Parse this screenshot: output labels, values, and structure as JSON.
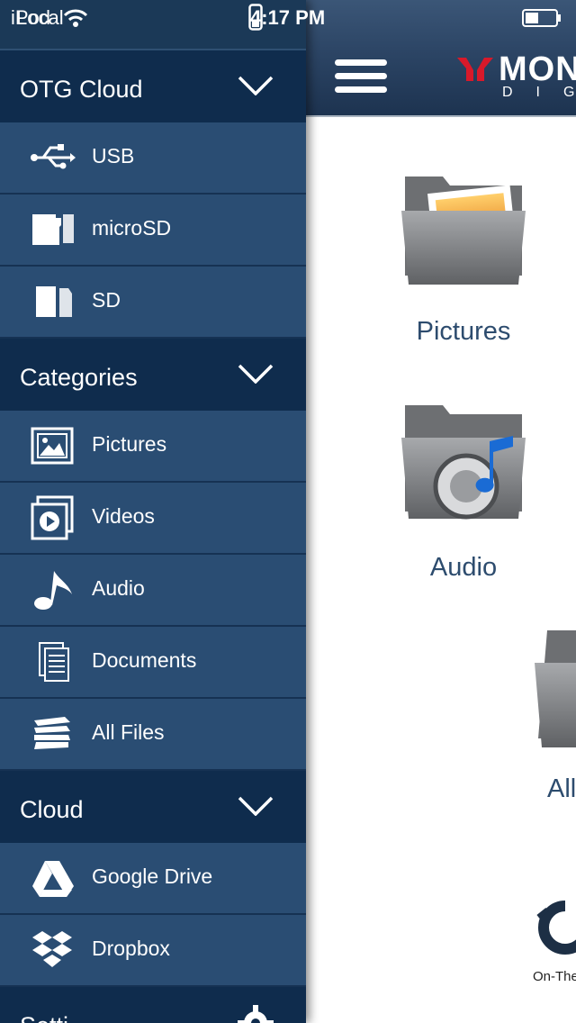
{
  "status_bar": {
    "carrier": "iPod",
    "time": "4:17 PM"
  },
  "drawer": {
    "top_label": "Local",
    "sections": [
      {
        "title": "OTG Cloud",
        "items": [
          {
            "label": "USB",
            "icon": "usb-icon"
          },
          {
            "label": "microSD",
            "icon": "microsd-icon"
          },
          {
            "label": "SD",
            "icon": "sd-card-icon"
          }
        ]
      },
      {
        "title": "Categories",
        "items": [
          {
            "label": "Pictures",
            "icon": "pictures-icon"
          },
          {
            "label": "Videos",
            "icon": "videos-icon"
          },
          {
            "label": "Audio",
            "icon": "music-note-icon"
          },
          {
            "label": "Documents",
            "icon": "documents-icon"
          },
          {
            "label": "All Files",
            "icon": "all-files-icon"
          }
        ]
      },
      {
        "title": "Cloud",
        "items": [
          {
            "label": "Google Drive",
            "icon": "google-drive-icon"
          },
          {
            "label": "Dropbox",
            "icon": "dropbox-icon"
          }
        ]
      },
      {
        "title": "Setti"
      }
    ]
  },
  "main": {
    "logo": {
      "text": "MON",
      "subtext": "DIG"
    },
    "tiles": [
      {
        "label": "Pictures"
      },
      {
        "label": "Audio"
      },
      {
        "label": "All"
      }
    ],
    "brand": {
      "text": "On-The"
    }
  },
  "colors": {
    "drawer_bg": "#234469",
    "section_bg": "#0f2c4d",
    "item_bg": "#2a4d73",
    "tile_label": "#2d4c6e"
  }
}
